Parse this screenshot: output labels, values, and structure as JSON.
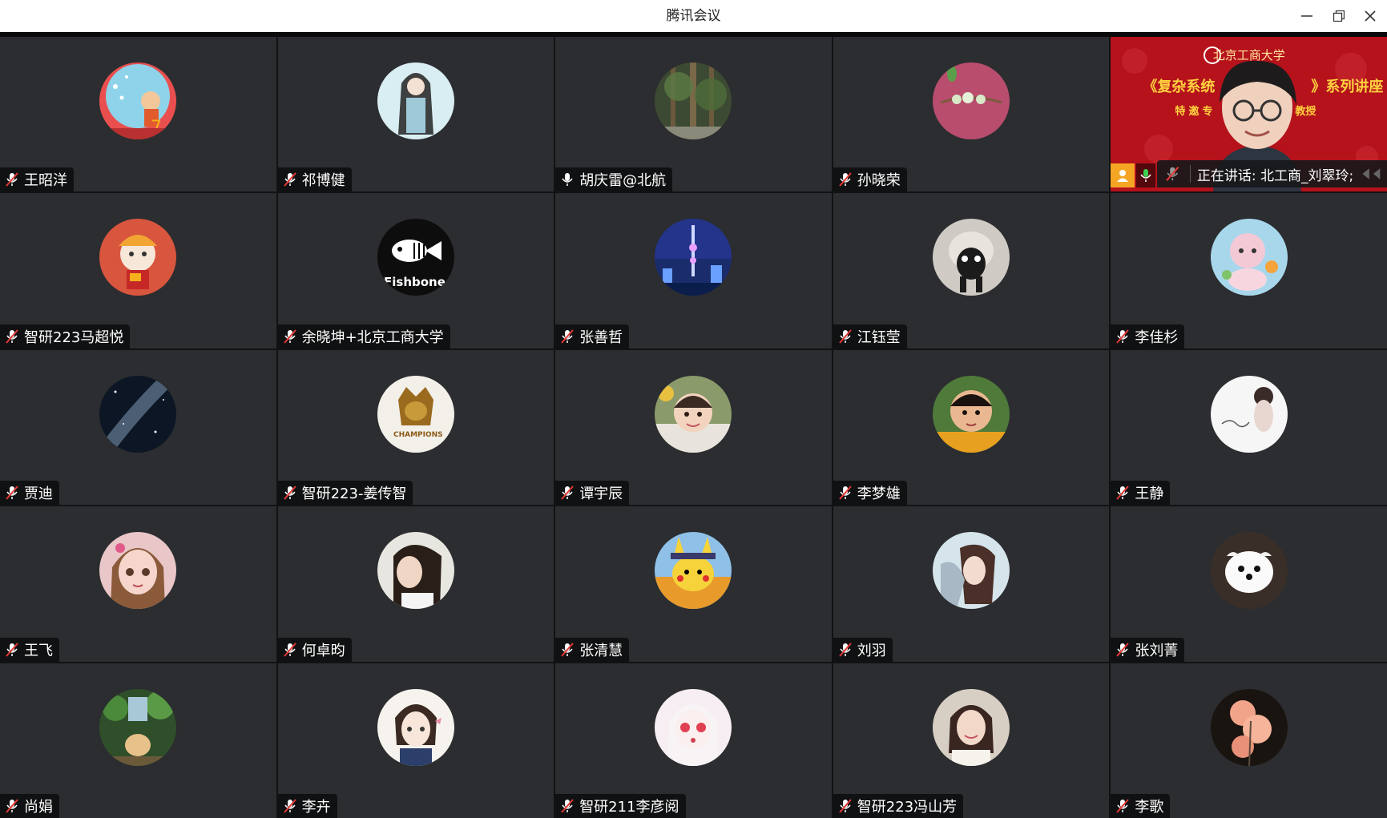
{
  "window": {
    "title": "腾讯会议",
    "controls": [
      "minimize-icon",
      "restore-icon",
      "close-icon"
    ]
  },
  "speaker_tile": {
    "banner_top": "北京工商大学",
    "banner_title": "《复杂系统",
    "banner_title_end": "》系列讲座",
    "banner_sub": "特邀专",
    "banner_sub_end": "教授",
    "speaking_text": "正在讲话: 北工商_刘翠玲;"
  },
  "participants": [
    {
      "name": "王昭洋",
      "mic": "muted"
    },
    {
      "name": "祁博健",
      "mic": "muted"
    },
    {
      "name": "胡庆雷@北航",
      "mic": "on"
    },
    {
      "name": "孙晓荣",
      "mic": "muted"
    },
    {
      "name": "北工商_刘翠玲",
      "mic": "speaking"
    },
    {
      "name": "智研223马超悦",
      "mic": "muted"
    },
    {
      "name": "余晓坤+北京工商大学",
      "mic": "muted"
    },
    {
      "name": "张善哲",
      "mic": "muted"
    },
    {
      "name": "江钰莹",
      "mic": "muted"
    },
    {
      "name": "李佳杉",
      "mic": "muted"
    },
    {
      "name": "贾迪",
      "mic": "muted"
    },
    {
      "name": "智研223-姜传智",
      "mic": "muted"
    },
    {
      "name": "谭宇辰",
      "mic": "muted"
    },
    {
      "name": "李梦雄",
      "mic": "muted"
    },
    {
      "name": "王静",
      "mic": "muted"
    },
    {
      "name": "王飞",
      "mic": "muted"
    },
    {
      "name": "何卓昀",
      "mic": "muted"
    },
    {
      "name": "张清慧",
      "mic": "muted"
    },
    {
      "name": "刘羽",
      "mic": "muted"
    },
    {
      "name": "张刘菁",
      "mic": "muted"
    },
    {
      "name": "尚娟",
      "mic": "muted"
    },
    {
      "name": "李卉",
      "mic": "muted"
    },
    {
      "name": "智研211李彦阅",
      "mic": "muted"
    },
    {
      "name": "智研223冯山芳",
      "mic": "muted"
    },
    {
      "name": "李歌",
      "mic": "muted"
    }
  ],
  "avatar_avatar_text": "Fishbone",
  "avatar_champions_text": "CHAMPIONS"
}
